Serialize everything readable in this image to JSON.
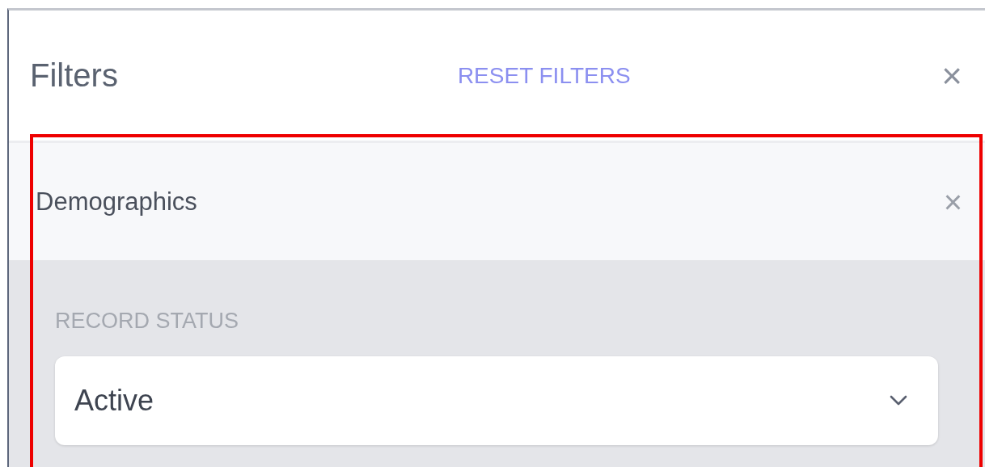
{
  "header": {
    "title": "Filters",
    "reset_label": "RESET FILTERS",
    "close_label": "×"
  },
  "section": {
    "title": "Demographics",
    "close_label": "×",
    "expanded": true
  },
  "field": {
    "label": "RECORD STATUS",
    "value": "Active"
  },
  "highlight": {
    "shown": true
  }
}
